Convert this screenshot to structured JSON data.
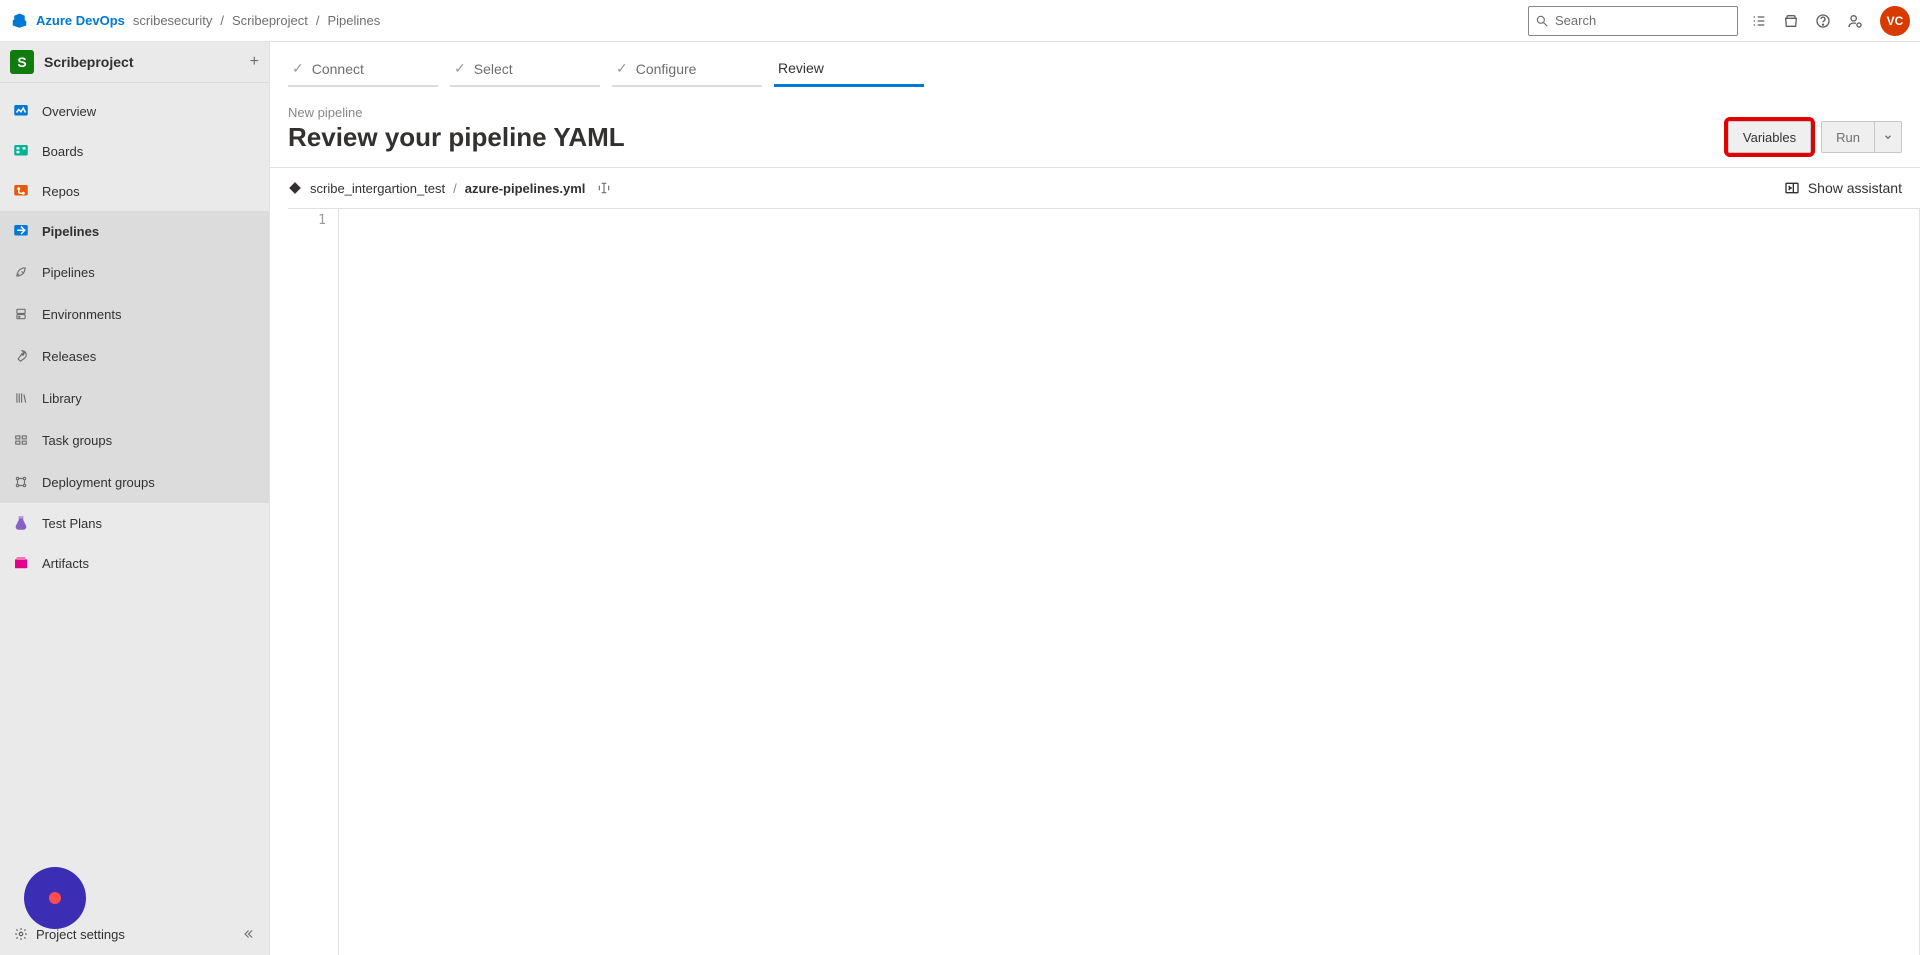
{
  "header": {
    "brand": "Azure DevOps",
    "crumbs": [
      "scribesecurity",
      "Scribeproject",
      "Pipelines"
    ],
    "search_placeholder": "Search",
    "avatar_initials": "VC"
  },
  "sidebar": {
    "project_initial": "S",
    "project_name": "Scribeproject",
    "items": [
      {
        "label": "Overview",
        "icon": "overview"
      },
      {
        "label": "Boards",
        "icon": "boards"
      },
      {
        "label": "Repos",
        "icon": "repos"
      },
      {
        "label": "Pipelines",
        "icon": "pipelines",
        "selected": true,
        "children": [
          {
            "label": "Pipelines"
          },
          {
            "label": "Environments"
          },
          {
            "label": "Releases"
          },
          {
            "label": "Library"
          },
          {
            "label": "Task groups"
          },
          {
            "label": "Deployment groups"
          }
        ]
      },
      {
        "label": "Test Plans",
        "icon": "testplans"
      },
      {
        "label": "Artifacts",
        "icon": "artifacts"
      }
    ],
    "settings_label": "Project settings"
  },
  "wizard": {
    "steps": [
      "Connect",
      "Select",
      "Configure",
      "Review"
    ],
    "active_index": 3
  },
  "page": {
    "kicker": "New pipeline",
    "title": "Review your pipeline YAML",
    "variables_label": "Variables",
    "run_label": "Run",
    "repo_name": "scribe_intergartion_test",
    "file_name": "azure-pipelines.yml",
    "assistant_label": "Show assistant"
  },
  "editor": {
    "line_numbers": [
      "1"
    ]
  }
}
